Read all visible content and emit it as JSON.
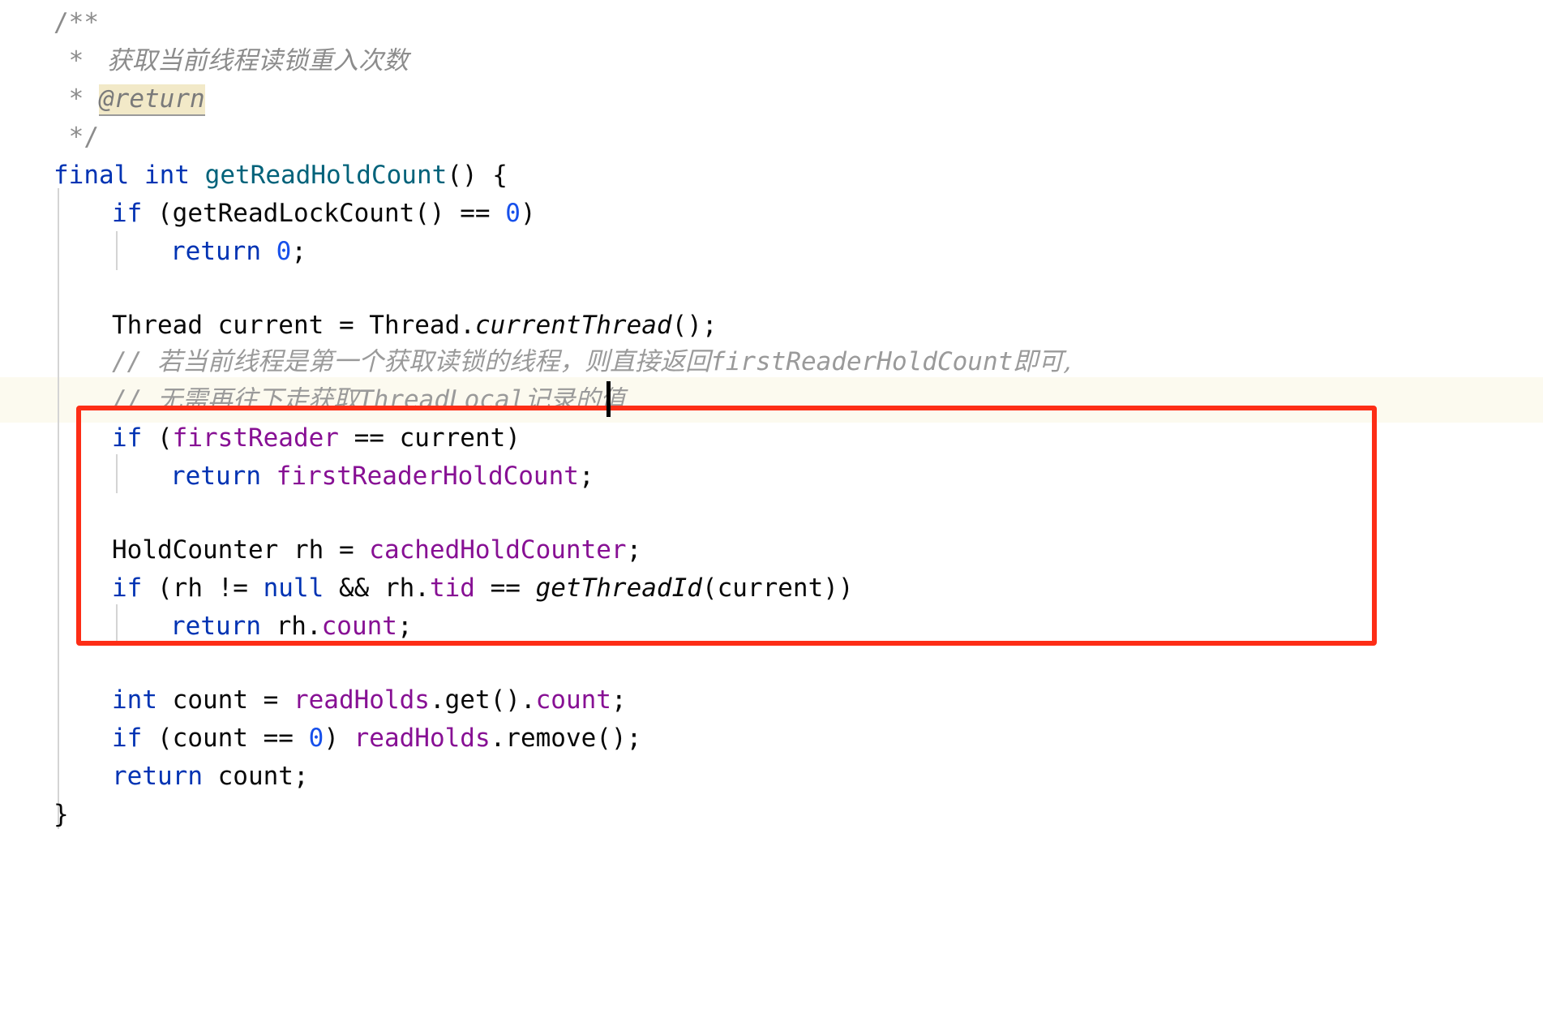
{
  "editor": {
    "language": "java",
    "background_color": "#ffffff",
    "current_line_highlight_color": "#fcfaef",
    "annotation_box_color": "#fd2d16",
    "colors": {
      "keyword": "#0033b3",
      "number": "#1750eb",
      "field": "#871094",
      "method_declaration": "#00627a",
      "comment": "#8c8c8c",
      "javadoc_tag_highlight": "#f2e9c8",
      "plain_text": "#080808"
    },
    "caret": {
      "line_index": 10,
      "visible": true
    },
    "lines": [
      {
        "indent": 0,
        "text": "/**"
      },
      {
        "indent": 0,
        "text": " *  获取当前线程读锁重入次数"
      },
      {
        "indent": 0,
        "text": " * @return"
      },
      {
        "indent": 0,
        "text": " */"
      },
      {
        "indent": 0,
        "text": "final int getReadHoldCount() {"
      },
      {
        "indent": 1,
        "text": "if (getReadLockCount() == 0)"
      },
      {
        "indent": 2,
        "text": "return 0;"
      },
      {
        "indent": 0,
        "text": ""
      },
      {
        "indent": 1,
        "text": "Thread current = Thread.currentThread();"
      },
      {
        "indent": 1,
        "text": "// 若当前线程是第一个获取读锁的线程，则直接返回firstReaderHoldCount即可,"
      },
      {
        "indent": 1,
        "text": "// 无需再往下走获取ThreadLocal记录的值"
      },
      {
        "indent": 1,
        "text": "if (firstReader == current)"
      },
      {
        "indent": 2,
        "text": "return firstReaderHoldCount;"
      },
      {
        "indent": 0,
        "text": ""
      },
      {
        "indent": 1,
        "text": "HoldCounter rh = cachedHoldCounter;"
      },
      {
        "indent": 1,
        "text": "if (rh != null && rh.tid == getThreadId(current))"
      },
      {
        "indent": 2,
        "text": "return rh.count;"
      },
      {
        "indent": 0,
        "text": ""
      },
      {
        "indent": 1,
        "text": "int count = readHolds.get().count;"
      },
      {
        "indent": 1,
        "text": "if (count == 0) readHolds.remove();"
      },
      {
        "indent": 1,
        "text": "return count;"
      },
      {
        "indent": 0,
        "text": "}"
      }
    ],
    "tokens": {
      "javadoc_open": "/**",
      "javadoc_star": " * ",
      "javadoc_summary": " 获取当前线程读锁重入次数",
      "javadoc_return_tag": "@return",
      "javadoc_close": " */",
      "kw_final": "final",
      "kw_int": "int",
      "kw_if": "if",
      "kw_return": "return",
      "kw_null": "null",
      "method_name": "getReadHoldCount",
      "paren_open_brace": "() {",
      "if_readlockcount": " (getReadLockCount() == ",
      "zero": "0",
      "close_paren": ")",
      "return_zero_semi": ";",
      "thread_decl": "Thread current = Thread.",
      "current_thread_call": "currentThread",
      "call_parens_semi": "();",
      "comment_line_1_prefix": "// ",
      "comment_line_1_cn_a": "若当前线程是第一个获取读锁的线程，则直接返回",
      "comment_line_1_mono": "firstReaderHoldCount",
      "comment_line_1_cn_b": "即可,",
      "comment_line_2_prefix": "// ",
      "comment_line_2_cn_a": "无需再往下走获取",
      "comment_line_2_mono": "ThreadLocal",
      "comment_line_2_cn_b": "记录的值",
      "if_open": " (",
      "first_reader": "firstReader",
      "eq_current": " == current)",
      "first_reader_hold_count": "firstReaderHoldCount",
      "semi": ";",
      "hold_counter_decl": "HoldCounter rh = ",
      "cached_hold_counter": "cachedHoldCounter",
      "if_rh_a": " (rh != ",
      "if_rh_b": " && rh.",
      "tid": "tid",
      "if_rh_c": " == ",
      "get_thread_id": "getThreadId",
      "if_rh_d": "(current))",
      "return_rh": " rh.",
      "count_field": "count",
      "int_count_a": " count = ",
      "read_holds": "readHolds",
      "int_count_b": ".get().",
      "int_count_c": ";",
      "if_count_a": " (count == ",
      "if_count_b": ") ",
      "remove_call": ".remove();",
      "return_count": " count;",
      "close_brace": "}"
    }
  }
}
